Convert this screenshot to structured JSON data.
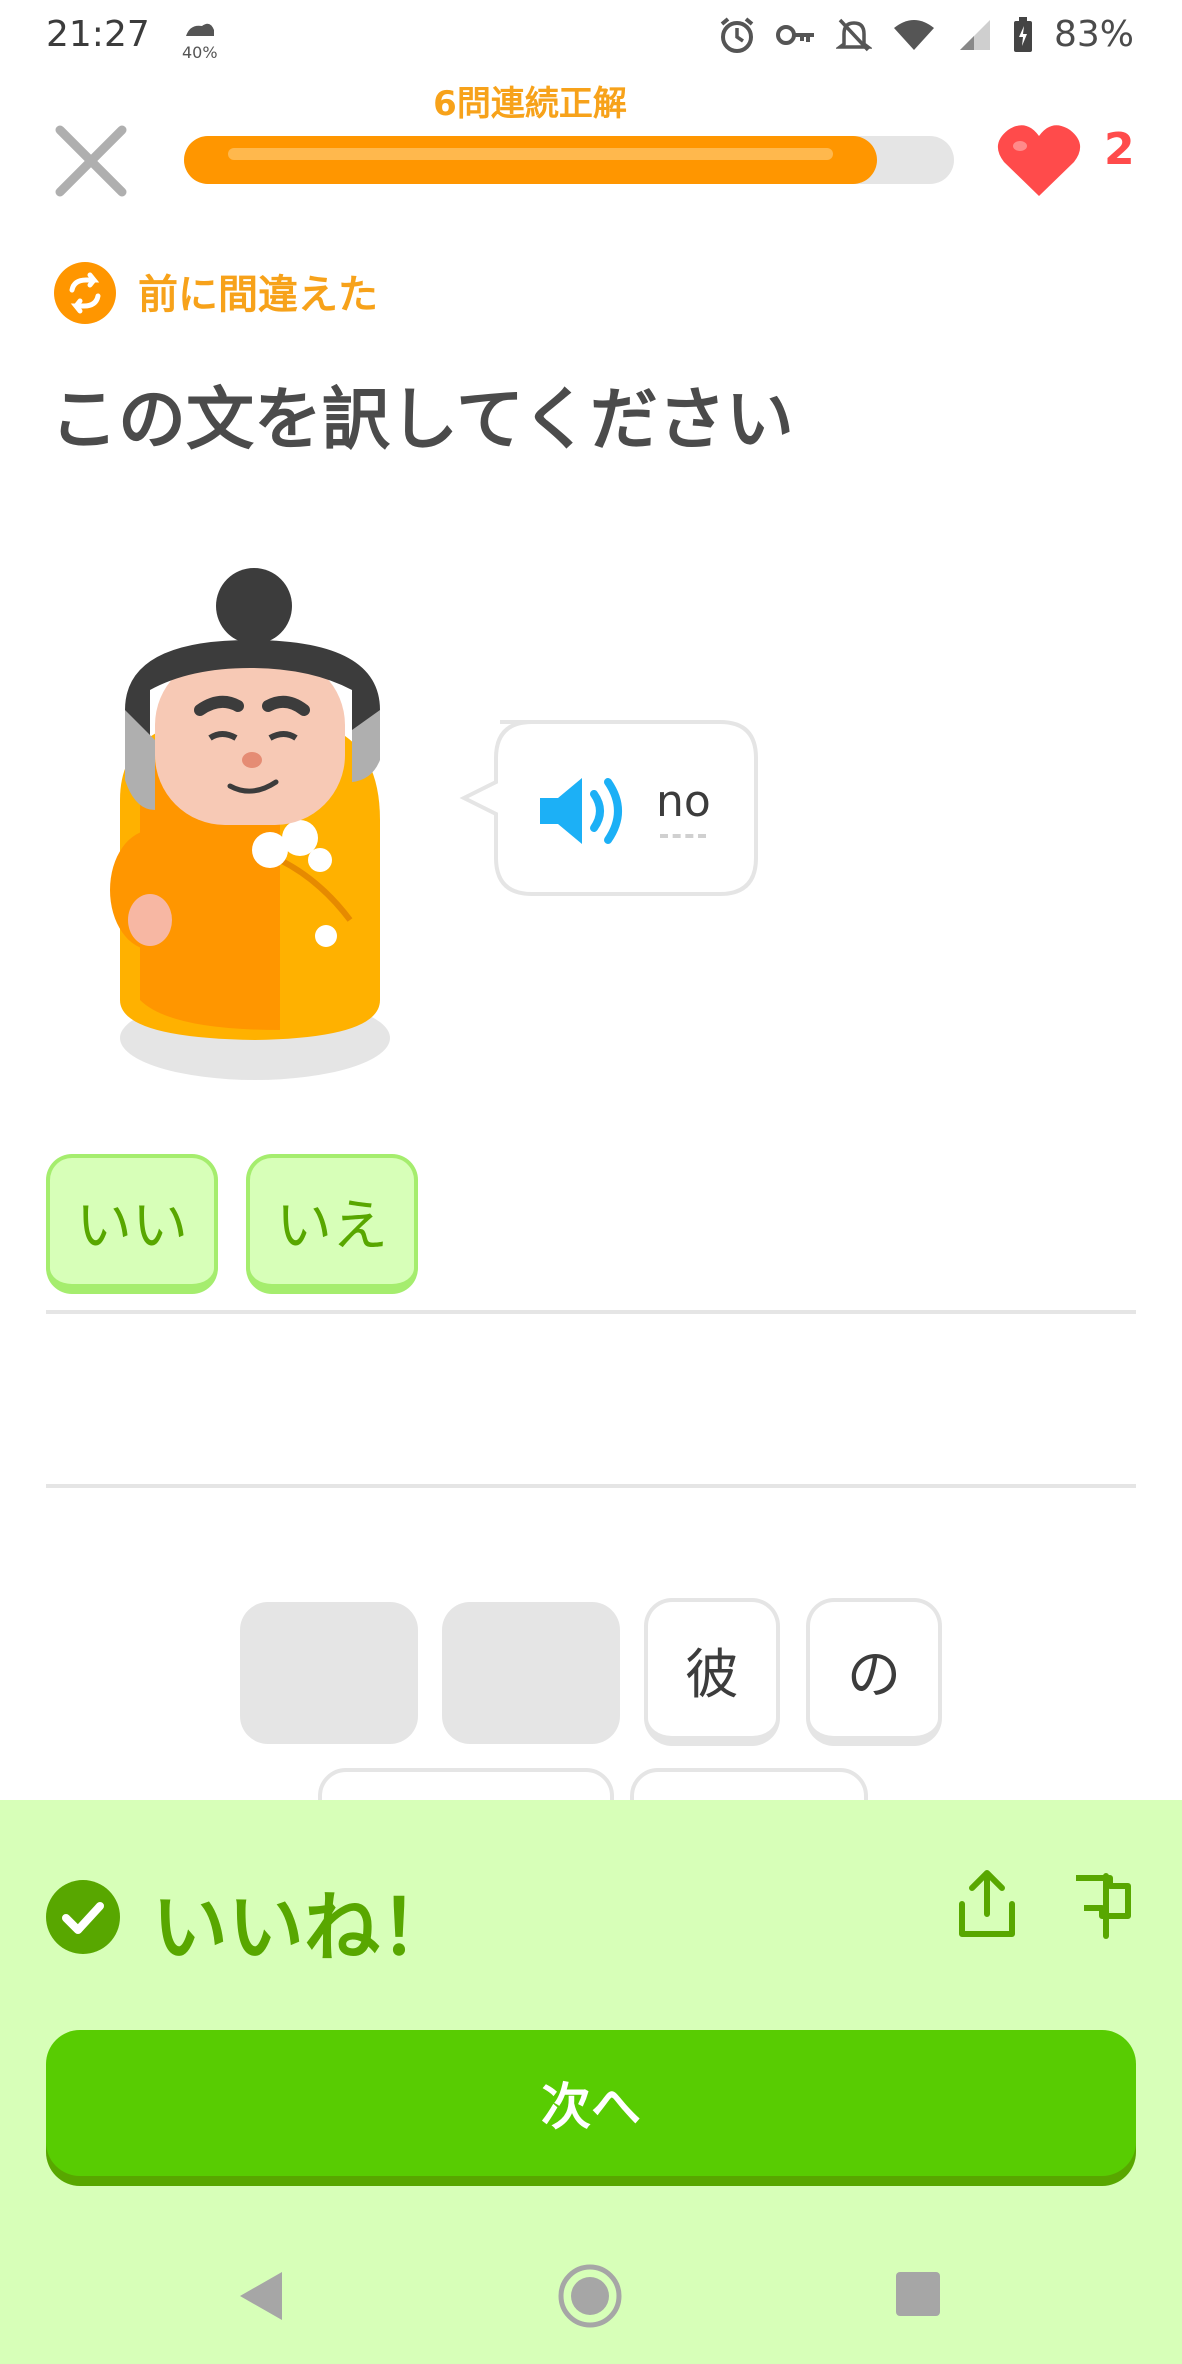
{
  "status_bar": {
    "time": "21:27",
    "weather_pct": "40%",
    "battery": "83%",
    "icons": [
      "alarm-icon",
      "key-icon",
      "mute-bell-icon",
      "wifi-icon",
      "signal-icon",
      "battery-icon"
    ]
  },
  "header": {
    "streak_label": "6問連続正解",
    "progress_fraction": 0.9,
    "hearts": "2"
  },
  "badge": {
    "label": "前に間違えた"
  },
  "title": "この文を訳してください",
  "prompt": {
    "word": "no"
  },
  "answer_tiles": [
    "いい",
    "いえ"
  ],
  "word_bank": [
    "彼",
    "の"
  ],
  "feedback": {
    "title": "いいね！",
    "button_label": "次へ"
  },
  "colors": {
    "accent_orange": "#ff9600",
    "success_green": "#58cc02",
    "panel_green": "#d7ffb8",
    "heart_red": "#ff4b4b"
  }
}
